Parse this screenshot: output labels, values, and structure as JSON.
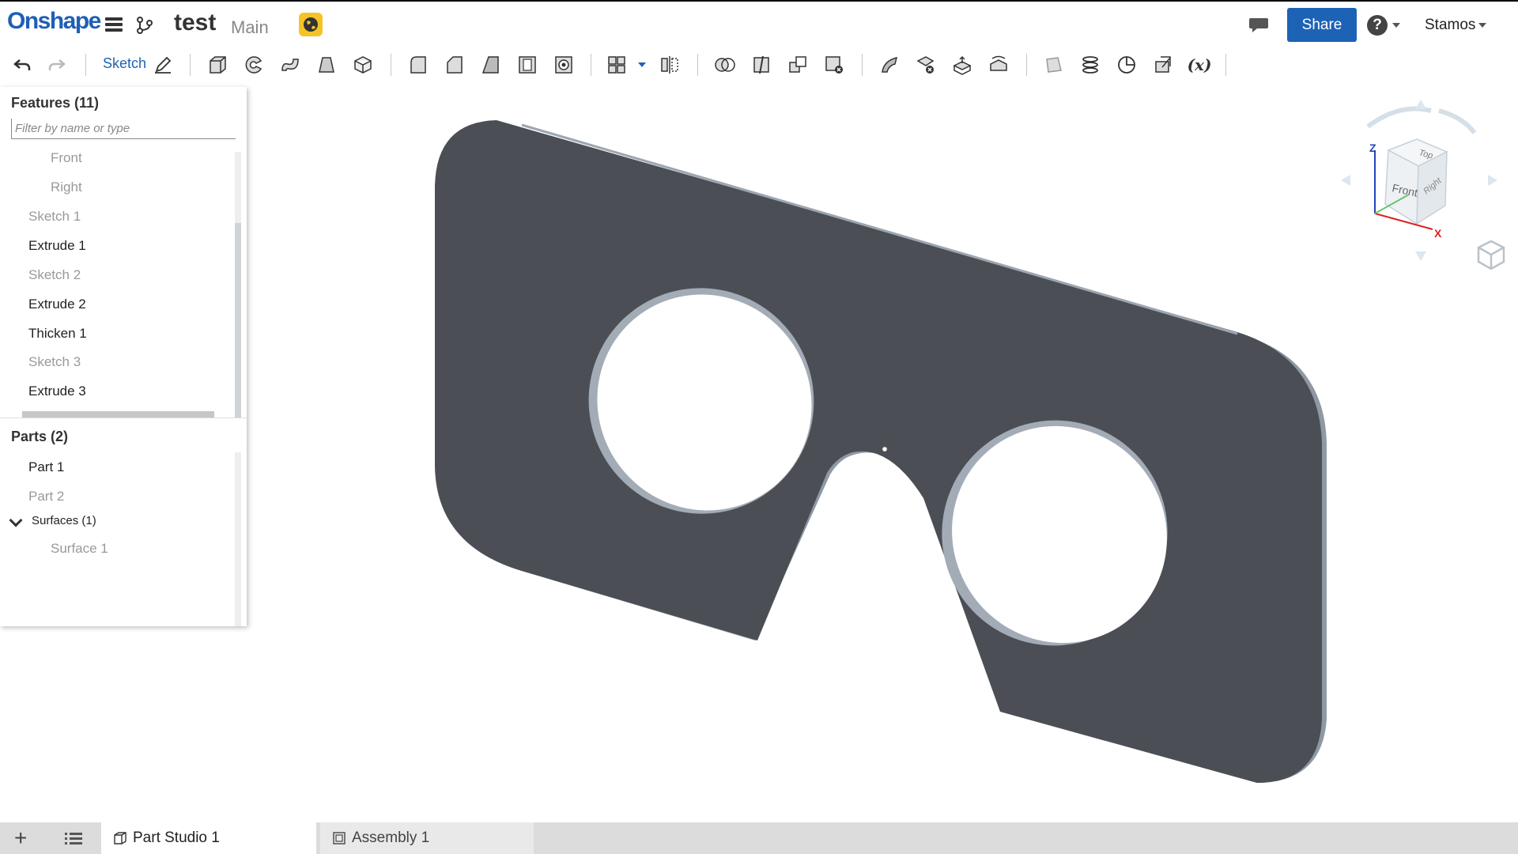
{
  "topbar": {
    "logo": "Onshape",
    "document_name": "test",
    "workspace": "Main",
    "share_label": "Share",
    "user_name": "Stamos"
  },
  "toolbar": {
    "sketch_label": "Sketch",
    "variable_label": "(x)"
  },
  "features_panel": {
    "title": "Features (11)",
    "filter_placeholder": "Filter by name or type",
    "items": [
      {
        "label": "Front"
      },
      {
        "label": "Right"
      },
      {
        "label": "Sketch 1"
      },
      {
        "label": "Extrude 1"
      },
      {
        "label": "Sketch 2"
      },
      {
        "label": "Extrude 2"
      },
      {
        "label": "Thicken 1"
      },
      {
        "label": "Sketch 3"
      },
      {
        "label": "Extrude 3"
      }
    ]
  },
  "parts_panel": {
    "title": "Parts (2)",
    "items": [
      {
        "label": "Part 1"
      },
      {
        "label": "Part 2"
      }
    ],
    "surfaces_group": "Surfaces (1)",
    "surfaces": [
      {
        "label": "Surface 1"
      }
    ]
  },
  "view_cube": {
    "faces": {
      "top": "Top",
      "front": "Front",
      "right": "Right"
    },
    "axes": {
      "z": "Z",
      "x": "X"
    }
  },
  "tabs": [
    {
      "label": "Part Studio 1"
    },
    {
      "label": "Assembly 1"
    }
  ],
  "colors": {
    "brand": "#1f5fb5",
    "share": "#1d63b5",
    "part_face": "#4b4f55",
    "part_edge": "#8e99a6"
  }
}
